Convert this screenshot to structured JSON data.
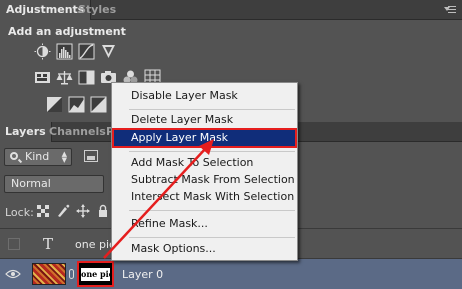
{
  "adjustments_panel": {
    "tabs": [
      {
        "label": "Adjustments",
        "active": true
      },
      {
        "label": "Styles",
        "active": false
      }
    ],
    "title": "Add an adjustment",
    "icons_row1": [
      "brightness-contrast-icon",
      "levels-icon",
      "curves-icon",
      "exposure-icon"
    ],
    "icons_row2": [
      "vibrance-icon",
      "color-balance-icon",
      "black-white-icon",
      "photo-filter-icon",
      "channel-mixer-icon",
      "color-lookup-icon"
    ],
    "icons_row3": [
      "invert-icon",
      "posterize-icon",
      "threshold-icon",
      "gradient-map-icon"
    ]
  },
  "layers_panel": {
    "tabs": [
      {
        "label": "Layers",
        "active": true
      },
      {
        "label": "Channels",
        "active": false
      },
      {
        "label": "P",
        "active": false
      }
    ],
    "filter_kind": "Kind",
    "blend_mode": "Normal",
    "lock_label": "Lock:",
    "layers": [
      {
        "name": "one pie",
        "type": "text",
        "visible": false
      },
      {
        "name": "Layer 0",
        "type": "image",
        "visible": true,
        "selected": true,
        "mask_text": "one piece"
      }
    ]
  },
  "context_menu": {
    "items": [
      {
        "label": "Disable Layer Mask",
        "selected": false
      },
      {
        "label": "Delete Layer Mask",
        "selected": false
      },
      {
        "label": "Apply Layer Mask",
        "selected": true
      },
      {
        "label": "Add Mask To Selection",
        "selected": false
      },
      {
        "label": "Subtract Mask From Selection",
        "selected": false
      },
      {
        "label": "Intersect Mask With Selection",
        "selected": false
      },
      {
        "label": "Refine Mask...",
        "selected": false
      },
      {
        "label": "Mask Options...",
        "selected": false
      }
    ]
  },
  "colors": {
    "panel_bg": "#535353",
    "selected_row": "#5b6a86",
    "menu_highlight": "#102d7a",
    "annotation_red": "#e51e1e"
  }
}
